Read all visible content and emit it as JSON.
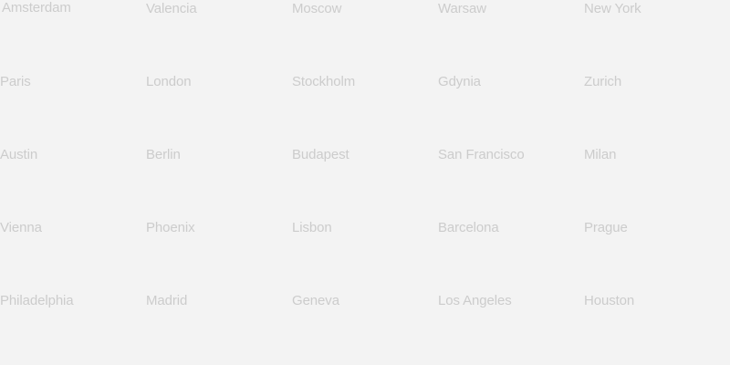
{
  "cities": [
    [
      "Amsterdam",
      "Valencia",
      "Moscow",
      "Warsaw",
      "New York"
    ],
    [
      "Paris",
      "London",
      "Stockholm",
      "Gdynia",
      "Zurich"
    ],
    [
      "Austin",
      "Berlin",
      "Budapest",
      "San Francisco",
      "Milan"
    ],
    [
      "Vienna",
      "Phoenix",
      "Lisbon",
      "Barcelona",
      "Prague"
    ],
    [
      "Philadelphia",
      "Madrid",
      "Geneva",
      "Los Angeles",
      "Houston"
    ]
  ],
  "colors": {
    "background": "#f3f3f3",
    "label": "#cccccc"
  }
}
